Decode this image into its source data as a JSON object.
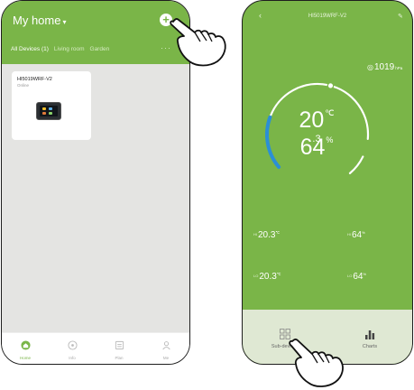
{
  "home": {
    "title": "My home",
    "title_caret": "▾",
    "add_symbol": "+",
    "tabs": [
      {
        "label": "All Devices (1)",
        "active": true
      },
      {
        "label": "Living room",
        "active": false
      },
      {
        "label": "Garden",
        "active": false
      }
    ],
    "more_symbol": "···",
    "device": {
      "name": "HI5019WRF-V2",
      "status": "Online"
    },
    "nav": [
      {
        "label": "Home",
        "icon": "home-icon",
        "active": true
      },
      {
        "label": "Info",
        "icon": "info-icon",
        "active": false
      },
      {
        "label": "Plan",
        "icon": "plan-icon",
        "active": false
      },
      {
        "label": "Me",
        "icon": "me-icon",
        "active": false
      }
    ]
  },
  "detail": {
    "back_symbol": "‹",
    "title": "HI5019WRF-V2",
    "edit_symbol": "✎",
    "pressure": {
      "icon": "◎",
      "value": "1019",
      "unit": "hPa"
    },
    "temperature": {
      "value": "20",
      "unit": "℃",
      "decimal": ".3"
    },
    "humidity": {
      "value": "64",
      "unit": "%"
    },
    "gauge_level": 0.72,
    "readings": {
      "max_temp": {
        "prefix": "HI",
        "value": "20.3",
        "unit": "℃"
      },
      "max_hum": {
        "prefix": "HI",
        "value": "64",
        "unit": "%"
      },
      "min_temp": {
        "prefix": "LO",
        "value": "20.3",
        "unit": "℃"
      },
      "min_hum": {
        "prefix": "LO",
        "value": "64",
        "unit": "%"
      }
    },
    "bottom": [
      {
        "label": "Sub-devices",
        "icon": "grid-icon"
      },
      {
        "label": "Charts",
        "icon": "bar-chart-icon"
      }
    ]
  },
  "colors": {
    "brand_green": "#7ab548",
    "gauge_blue": "#2b8fd6",
    "gauge_white": "#ffffff"
  }
}
